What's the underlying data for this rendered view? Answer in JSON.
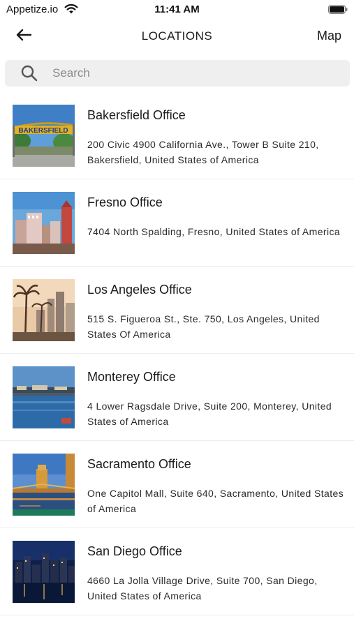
{
  "status_bar": {
    "carrier": "Appetize.io",
    "time": "11:41 AM"
  },
  "header": {
    "title": "LOCATIONS",
    "map_label": "Map"
  },
  "search": {
    "placeholder": "Search",
    "value": ""
  },
  "locations": [
    {
      "name": "Bakersfield Office",
      "address": "200 Civic 4900 California Ave., Tower B Suite 210, Bakersfield, United States of America",
      "image_sign": "BAKERSFIELD"
    },
    {
      "name": "Fresno Office",
      "address": "7404 North Spalding, Fresno, United States of America"
    },
    {
      "name": "Los Angeles Office",
      "address": "515 S. Figueroa St., Ste. 750, Los Angeles, United States Of America"
    },
    {
      "name": "Monterey Office",
      "address": "4 Lower Ragsdale Drive, Suite 200, Monterey, United States of America"
    },
    {
      "name": "Sacramento Office",
      "address": "One Capitol Mall, Suite 640, Sacramento, United States of America"
    },
    {
      "name": "San Diego Office",
      "address": "4660 La Jolla Village Drive, Suite 700, San Diego, United States of America"
    }
  ],
  "icons": {
    "back": "arrow-left-icon",
    "search": "search-icon",
    "wifi": "wifi-icon",
    "battery": "battery-icon"
  }
}
